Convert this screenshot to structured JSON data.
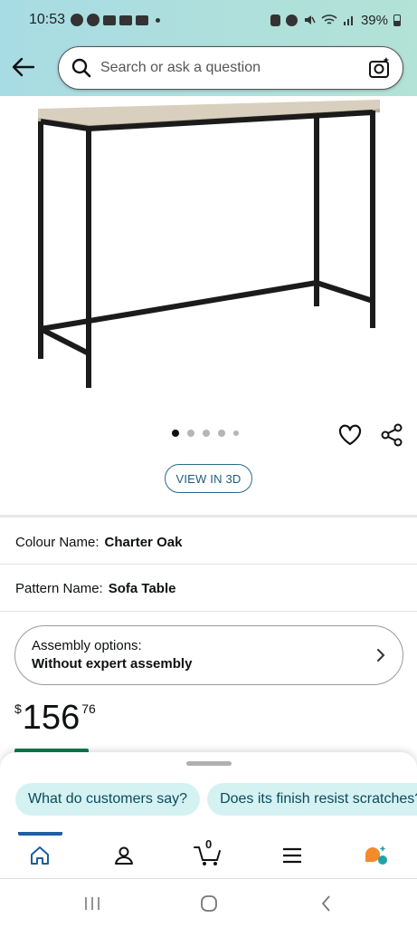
{
  "status_bar": {
    "time": "10:53",
    "battery": "39%",
    "notification_icons": [
      "whatsapp-icon",
      "messenger-icon",
      "mail-icon",
      "mail-icon",
      "excel-icon"
    ],
    "system_icons": [
      "lock-icon",
      "alarm-icon",
      "mute-icon",
      "wifi-icon",
      "signal-icon",
      "battery-icon"
    ]
  },
  "header": {
    "back_icon": "arrow-left-icon",
    "search_placeholder": "Search or ask a question",
    "camera_icon": "camera-sparkle-icon"
  },
  "product": {
    "image_alt": "Sofa table with oak top and black metal frame",
    "carousel": {
      "count": 5,
      "active": 0
    },
    "view3d_label": "VIEW IN 3D",
    "colour_label": "Colour Name:",
    "colour_value": "Charter Oak",
    "pattern_label": "Pattern Name:",
    "pattern_value": "Sofa Table",
    "assembly_label": "Assembly options:",
    "assembly_value": "Without expert assembly",
    "price_currency": "$",
    "price_whole": "156",
    "price_fraction": "76"
  },
  "assistant_sheet": {
    "chips": [
      "What do customers say?",
      "Does its finish resist scratches?"
    ]
  },
  "tab_bar": {
    "tabs": [
      "home-icon",
      "account-icon",
      "cart-icon",
      "menu-icon",
      "rufus-icon"
    ],
    "active": "home-icon",
    "cart_count": "0"
  },
  "colors": {
    "header_gradient_start": "#a8dce4",
    "header_gradient_end": "#b3e2d6",
    "link_blue": "#1f5c80",
    "chip_bg": "#d5f2f3",
    "active_tab": "#1c5fa3"
  }
}
